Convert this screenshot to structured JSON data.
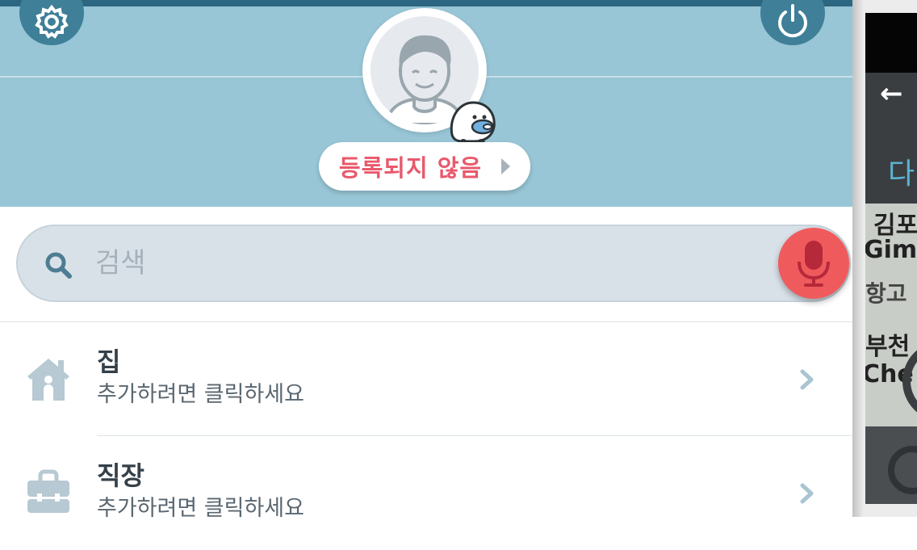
{
  "header": {
    "status_label": "등록되지 않음",
    "icons": [
      "gear-icon",
      "power-icon",
      "avatar-icon",
      "waze-mascot-icon"
    ]
  },
  "search": {
    "placeholder": "검색",
    "search_icon": "search-icon",
    "mic_icon": "microphone-icon"
  },
  "list": [
    {
      "icon": "home-icon",
      "title": "집",
      "subtitle": "추가하려면 클릭하세요"
    },
    {
      "icon": "briefcase-icon",
      "title": "직장",
      "subtitle": "추가하려면 클릭하세요"
    }
  ],
  "side_panel": {
    "back_glyph": "←",
    "destination_fragment": "다",
    "map_labels": [
      "김포",
      "Gimp",
      "항고",
      "부천",
      "Che"
    ]
  },
  "colors": {
    "header_bg": "#98c6d6",
    "header_buttons": "#3f7f98",
    "status_text": "#e9596c",
    "mic_button": "#ef5b5d",
    "search_bg": "#d9e1e8"
  }
}
